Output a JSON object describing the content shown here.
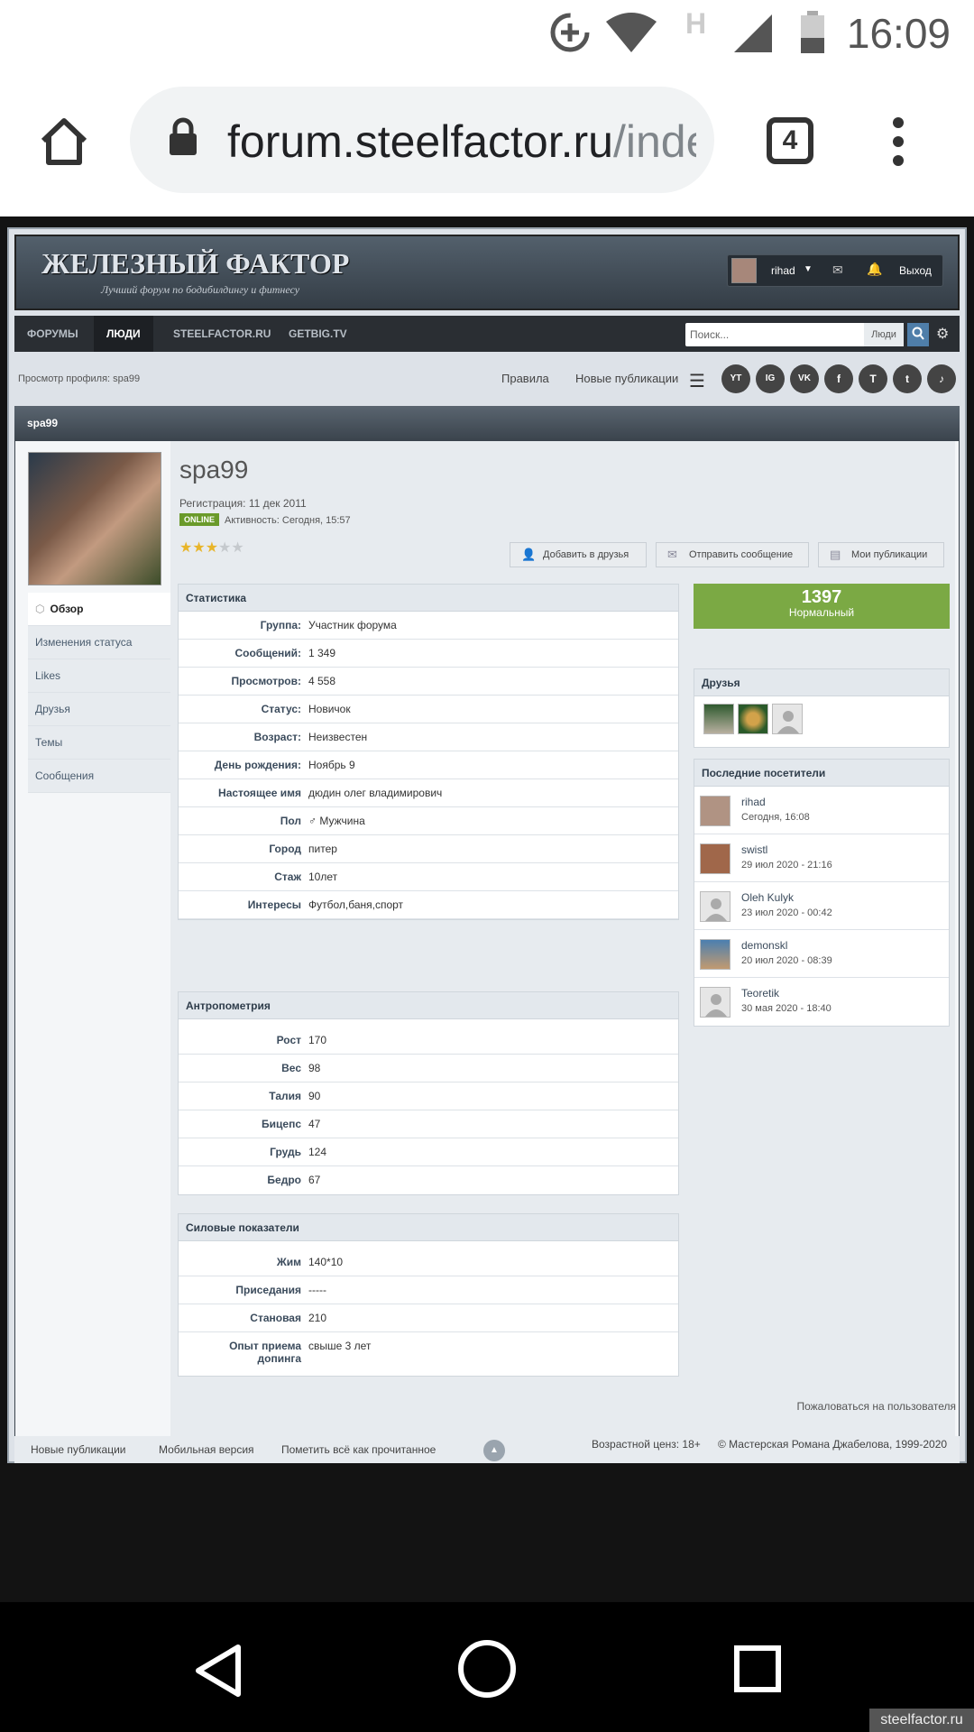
{
  "status_bar": {
    "time": "16:09",
    "network": "H"
  },
  "browser": {
    "url_domain": "forum.steelfactor.ru",
    "url_rest": "/inde",
    "tab_count": "4"
  },
  "site": {
    "logo_title": "ЖЕЛЕЗНЫЙ ФАКТОР",
    "logo_subtitle": "Лучший форум по бодибилдингу и фитнесу",
    "user": {
      "name": "rihad",
      "logout": "Выход"
    },
    "nav": [
      "ФОРУМЫ",
      "ЛЮДИ",
      "STEELFACTOR.RU",
      "GETBIG.TV"
    ],
    "search_placeholder": "Поиск...",
    "search_scope": "Люди",
    "breadcrumb": "Просмотр профиля: spa99",
    "links": {
      "rules": "Правила",
      "new_pubs": "Новые публикации"
    },
    "social": [
      "YT",
      "IG",
      "VK",
      "f",
      "T",
      "t",
      "♪"
    ]
  },
  "profile": {
    "title_bar": "spa99",
    "username": "spa99",
    "registration": "Регистрация: 11 дек 2011",
    "online_badge": "ONLINE",
    "activity": "Активность: Сегодня, 15:57",
    "rating_stars": 3,
    "actions": {
      "add_friend": "Добавить в друзья",
      "send_message": "Отправить сообщение",
      "my_pubs": "Мои публикации"
    },
    "sidenav": [
      "Обзор",
      "Изменения статуса",
      "Likes",
      "Друзья",
      "Темы",
      "Сообщения"
    ],
    "stats_header": "Статистика",
    "stats": [
      {
        "k": "Группа:",
        "v": "Участник форума"
      },
      {
        "k": "Сообщений:",
        "v": "1 349"
      },
      {
        "k": "Просмотров:",
        "v": "4 558"
      },
      {
        "k": "Статус:",
        "v": "Новичок"
      },
      {
        "k": "Возраст:",
        "v": "Неизвестен"
      },
      {
        "k": "День рождения:",
        "v": "Ноябрь 9"
      },
      {
        "k": "Настоящее имя",
        "v": "дюдин олег владимирович"
      },
      {
        "k": "Пол",
        "v": "♂ Мужчина"
      },
      {
        "k": "Город",
        "v": "питер"
      },
      {
        "k": "Стаж",
        "v": "10лет"
      },
      {
        "k": "Интересы",
        "v": "Футбол,баня,спорт"
      }
    ],
    "anthro_header": "Антропометрия",
    "anthro": [
      {
        "k": "Рост",
        "v": "170"
      },
      {
        "k": "Вес",
        "v": "98"
      },
      {
        "k": "Талия",
        "v": "90"
      },
      {
        "k": "Бицепс",
        "v": "47"
      },
      {
        "k": "Грудь",
        "v": "124"
      },
      {
        "k": "Бедро",
        "v": "67"
      }
    ],
    "power_header": "Силовые показатели",
    "power": [
      {
        "k": "Жим",
        "v": "140*10"
      },
      {
        "k": "Приседания",
        "v": "-----"
      },
      {
        "k": "Становая",
        "v": "210"
      },
      {
        "k": "Опыт приема допинга",
        "v": "свыше 3 лет"
      }
    ],
    "reputation": {
      "value": "1397",
      "label": "Нормальный"
    },
    "friends_header": "Друзья",
    "visitors_header": "Последние посетители",
    "visitors": [
      {
        "name": "rihad",
        "time": "Сегодня, 16:08"
      },
      {
        "name": "swistl",
        "time": "29 июл 2020 - 21:16"
      },
      {
        "name": "Oleh Kulyk",
        "time": "23 июл 2020 - 00:42"
      },
      {
        "name": "demonskl",
        "time": "20 июл 2020 - 08:39"
      },
      {
        "name": "Teoretik",
        "time": "30 мая 2020 - 18:40"
      }
    ]
  },
  "footer": {
    "complain": "Пожаловаться на пользователя",
    "links": [
      "Новые публикации",
      "Мобильная версия",
      "Пометить всё как прочитанное"
    ],
    "age_rating": "Возрастной ценз: 18+",
    "copyright": "© Мастерская Романа Джабелова, 1999-2020"
  },
  "watermark": "steelfactor.ru"
}
